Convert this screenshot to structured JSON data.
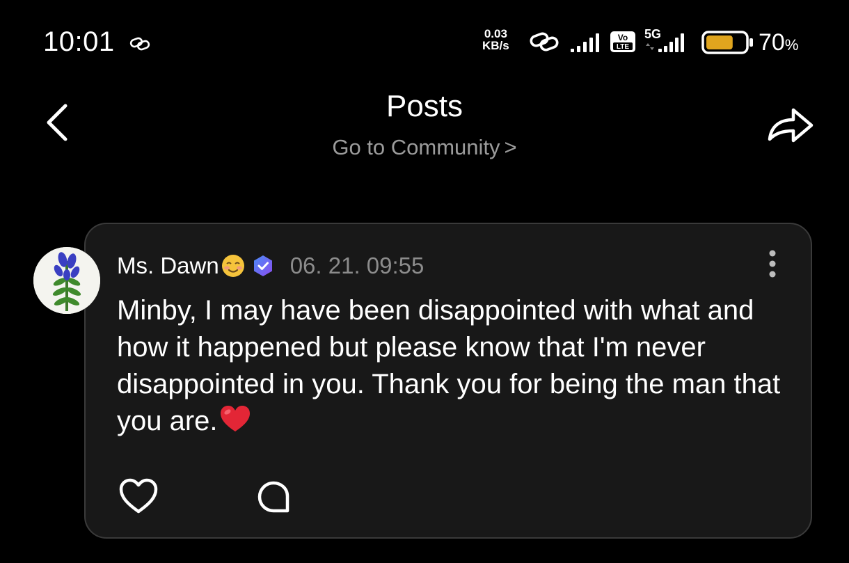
{
  "status_bar": {
    "time": "10:01",
    "net_speed_value": "0.03",
    "net_speed_unit": "KB/s",
    "volte": "Vo LTE",
    "network": "5G",
    "battery_level": 0.7,
    "battery_percent": "70",
    "percent_sign": "%"
  },
  "header": {
    "title": "Posts",
    "subtitle": "Go to Community",
    "subtitle_chevron": ">"
  },
  "post": {
    "author": "Ms. Dawn",
    "date": "06. 21. 09:55",
    "body": "Minby, I may have been disappointed with what and how it happened but please know that I'm never disappointed in you. Thank you for being the man that you are."
  },
  "colors": {
    "background": "#000000",
    "card": "#181818",
    "muted_text": "#9b9b9b",
    "battery_fill": "#e0a51e",
    "badge": "#6b5cf0"
  },
  "icons": [
    "link-icon",
    "signal-icon",
    "volte-icon",
    "battery-icon",
    "back-icon",
    "share-icon",
    "more-icon",
    "verified-badge-icon",
    "heart-icon",
    "comment-icon"
  ]
}
